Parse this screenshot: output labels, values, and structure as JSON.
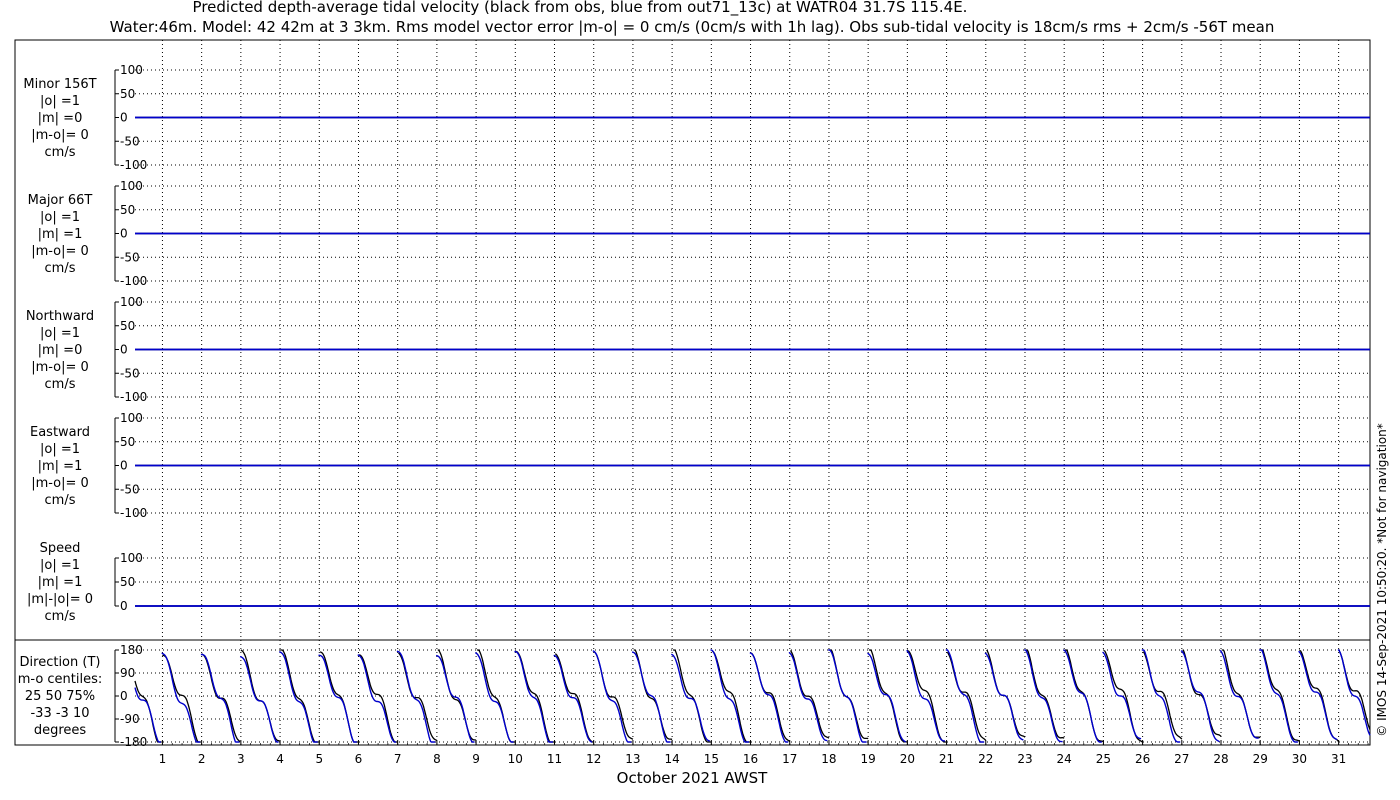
{
  "title_line1": "Predicted depth-average tidal velocity (black from obs, blue from out71_13c) at WATR04 31.7S 115.4E.",
  "title_line2": "Water:46m. Model: 42 42m at 3 3km. Rms model vector error |m-o| = 0 cm/s (0cm/s with 1h lag). Obs sub-tidal velocity is 18cm/s rms + 2cm/s -56T mean",
  "xlabel": "October 2021 AWST",
  "credit": "© IMOS 14-Sep-2021 10:50:20. *Not for navigation*",
  "colors": {
    "obs": "#000000",
    "model": "#0000cc"
  },
  "chart_data": {
    "type": "line",
    "x_ticks": [
      "1",
      "2",
      "3",
      "4",
      "5",
      "6",
      "7",
      "8",
      "9",
      "10",
      "11",
      "12",
      "13",
      "14",
      "15",
      "16",
      "17",
      "18",
      "19",
      "20",
      "21",
      "22",
      "23",
      "24",
      "25",
      "26",
      "27",
      "28",
      "29",
      "30",
      "31"
    ],
    "xlim": [
      0.3,
      31.8
    ],
    "grid": true,
    "panels": [
      {
        "key": "minor",
        "labels": [
          "Minor 156T",
          "|o| =1",
          "|m| =0",
          "|m-o|= 0",
          "cm/s"
        ],
        "ylim": [
          -100,
          100
        ],
        "yticks": [
          "100",
          "50",
          "0",
          "-50",
          "-100"
        ],
        "series": [
          {
            "role": "obs",
            "values": [
              0
            ]
          },
          {
            "role": "model",
            "values": [
              0
            ]
          }
        ]
      },
      {
        "key": "major",
        "labels": [
          "Major 66T",
          "|o| =1",
          "|m| =1",
          "|m-o|= 0",
          "cm/s"
        ],
        "ylim": [
          -100,
          100
        ],
        "yticks": [
          "100",
          "50",
          "0",
          "-50",
          "-100"
        ],
        "series": [
          {
            "role": "obs",
            "values": [
              0
            ]
          },
          {
            "role": "model",
            "values": [
              0
            ]
          }
        ]
      },
      {
        "key": "north",
        "labels": [
          "Northward",
          "|o| =1",
          "|m| =0",
          "|m-o|= 0",
          "cm/s"
        ],
        "ylim": [
          -100,
          100
        ],
        "yticks": [
          "100",
          "50",
          "0",
          "-50",
          "-100"
        ],
        "series": [
          {
            "role": "obs",
            "values": [
              0
            ]
          },
          {
            "role": "model",
            "values": [
              0
            ]
          }
        ]
      },
      {
        "key": "east",
        "labels": [
          "Eastward",
          "|o| =1",
          "|m| =1",
          "|m-o|= 0",
          "cm/s"
        ],
        "ylim": [
          -100,
          100
        ],
        "yticks": [
          "100",
          "50",
          "0",
          "-50",
          "-100"
        ],
        "series": [
          {
            "role": "obs",
            "values": [
              0
            ]
          },
          {
            "role": "model",
            "values": [
              0
            ]
          }
        ]
      },
      {
        "key": "speed",
        "labels": [
          "Speed",
          "|o| =1",
          "|m| =1",
          "|m|-|o|= 0",
          "cm/s"
        ],
        "ylim": [
          0,
          100
        ],
        "yticks": [
          "100",
          "50",
          "0"
        ],
        "series": [
          {
            "role": "obs",
            "values": [
              0
            ]
          },
          {
            "role": "model",
            "values": [
              0
            ]
          }
        ]
      },
      {
        "key": "direction",
        "labels": [
          "Direction (T)",
          "m-o centiles:",
          "25  50  75%",
          "-33  -3  10",
          "degrees"
        ],
        "ylim": [
          -180,
          180
        ],
        "yticks": [
          "180",
          "90",
          "0",
          "-90",
          "-180"
        ],
        "series": [
          {
            "role": "obs",
            "shape": "sawtooth",
            "days": [
              0.3,
              31.8
            ],
            "range": [
              -180,
              180
            ]
          },
          {
            "role": "model",
            "shape": "sawtooth",
            "days": [
              0.3,
              31.8
            ],
            "range": [
              -180,
              180
            ]
          }
        ]
      }
    ]
  }
}
